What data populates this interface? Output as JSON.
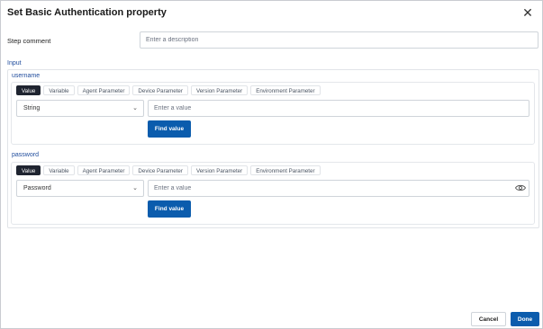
{
  "dialog": {
    "title": "Set Basic Authentication property",
    "close_icon": "close-icon"
  },
  "step_comment": {
    "label": "Step comment",
    "placeholder": "Enter a description"
  },
  "input_section": {
    "label": "Input"
  },
  "tabs": [
    "Value",
    "Variable",
    "Agent Parameter",
    "Device Parameter",
    "Version Parameter",
    "Environment Parameter"
  ],
  "params": [
    {
      "label": "username",
      "active_tab": "Value",
      "type_value": "String",
      "value_placeholder": "Enter a value",
      "find_label": "Find value"
    },
    {
      "label": "password",
      "active_tab": "Value",
      "type_value": "Password",
      "value_placeholder": "Enter a value",
      "find_label": "Find value",
      "reveal_icon": "eye-icon"
    }
  ],
  "footer": {
    "cancel_label": "Cancel",
    "done_label": "Done"
  },
  "colors": {
    "primary": "#0b5cad",
    "active_tab": "#1f2430",
    "section_label": "#1e4b9c"
  }
}
